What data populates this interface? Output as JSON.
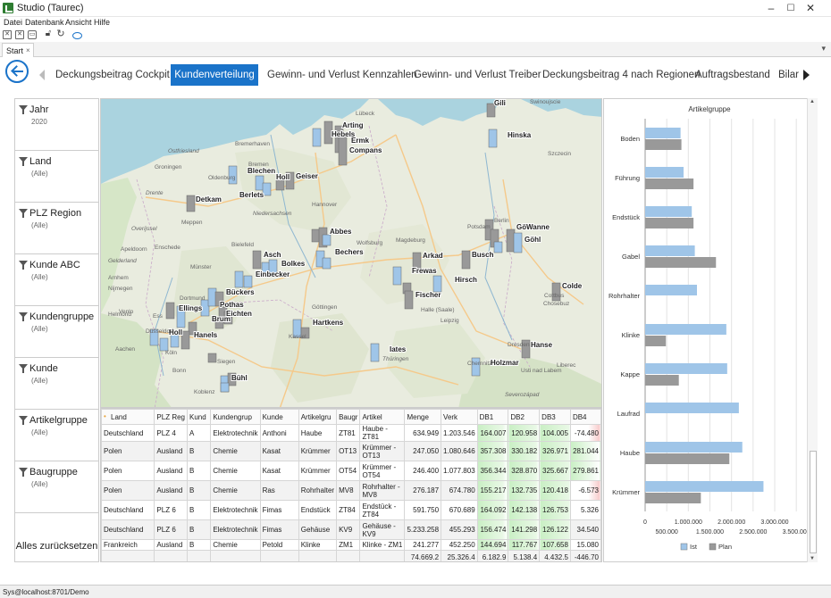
{
  "window": {
    "title": "Studio (Taurec)",
    "minimize": "–",
    "maximize": "☐",
    "close": "✕"
  },
  "menu": [
    "Datei",
    "Datenbank",
    "Ansicht",
    "Hilfe"
  ],
  "toolbar_icons": [
    "close-all-icon",
    "close-icon",
    "print-icon",
    "lock-icon",
    "refresh-icon",
    "eye-icon"
  ],
  "doc_tab": {
    "label": "Start",
    "close": "×",
    "dropdown": "▾"
  },
  "nav_tabs": [
    {
      "label": "Deckungsbeitrag Cockpit",
      "active": false
    },
    {
      "label": "Kundenverteilung",
      "active": true
    },
    {
      "label": "Gewinn- und Verlust Kennzahlen",
      "active": false
    },
    {
      "label": "Gewinn- und Verlust Treiber",
      "active": false
    },
    {
      "label": "Deckungsbeitrag 4 nach Regionen",
      "active": false
    },
    {
      "label": "Auftragsbestand",
      "active": false
    },
    {
      "label": "Bilar",
      "active": false
    }
  ],
  "filters": [
    {
      "name": "Jahr",
      "value": "2020"
    },
    {
      "name": "Land",
      "value": "(Alle)"
    },
    {
      "name": "PLZ Region",
      "value": "(Alle)"
    },
    {
      "name": "Kunde ABC",
      "value": "(Alle)"
    },
    {
      "name": "Kundengruppe",
      "value": "(Alle)"
    },
    {
      "name": "Kunde",
      "value": "(Alle)"
    },
    {
      "name": "Artikelgruppe",
      "value": "(Alle)"
    },
    {
      "name": "Baugruppe",
      "value": "(Alle)"
    }
  ],
  "reset_label": "Alles zurücksetzen",
  "map": {
    "cities": [
      {
        "name": "Lübeck",
        "kind": "region"
      },
      {
        "name": "Arting",
        "kind": "customer"
      },
      {
        "name": "Hebels",
        "kind": "customer"
      },
      {
        "name": "Ermk",
        "kind": "customer"
      },
      {
        "name": "Compans",
        "kind": "customer"
      },
      {
        "name": "Gili",
        "kind": "customer"
      },
      {
        "name": "Hinska",
        "kind": "customer"
      },
      {
        "name": "Swinoujscie",
        "kind": "region"
      },
      {
        "name": "Bremerhaven",
        "kind": "region"
      },
      {
        "name": "Szczecin",
        "kind": "region"
      },
      {
        "name": "Blechen",
        "kind": "customer"
      },
      {
        "name": "Holl",
        "kind": "customer"
      },
      {
        "name": "Geiser",
        "kind": "customer"
      },
      {
        "name": "Groningen",
        "kind": "region"
      },
      {
        "name": "Berlets",
        "kind": "customer"
      },
      {
        "name": "Detkam",
        "kind": "customer"
      },
      {
        "name": "Drente",
        "kind": "region"
      },
      {
        "name": "Niedersachsen",
        "kind": "region"
      },
      {
        "name": "Overijssel",
        "kind": "region"
      },
      {
        "name": "Abbes",
        "kind": "customer"
      },
      {
        "name": "Berlin",
        "kind": "region"
      },
      {
        "name": "Görr",
        "kind": "customer"
      },
      {
        "name": "Wanne",
        "kind": "customer"
      },
      {
        "name": "Göhl",
        "kind": "customer"
      },
      {
        "name": "Wolfsburg",
        "kind": "region"
      },
      {
        "name": "Enschede",
        "kind": "region"
      },
      {
        "name": "Apeldoorn",
        "kind": "region"
      },
      {
        "name": "Gelderland",
        "kind": "region"
      },
      {
        "name": "Asch",
        "kind": "customer"
      },
      {
        "name": "Bolkes",
        "kind": "customer"
      },
      {
        "name": "Bechers",
        "kind": "customer"
      },
      {
        "name": "Arkad",
        "kind": "customer"
      },
      {
        "name": "Busch",
        "kind": "customer"
      },
      {
        "name": "Arnhem",
        "kind": "region"
      },
      {
        "name": "Nijmegen",
        "kind": "region"
      },
      {
        "name": "Einbecker",
        "kind": "customer"
      },
      {
        "name": "Frewas",
        "kind": "customer"
      },
      {
        "name": "Hirsch",
        "kind": "customer"
      },
      {
        "name": "Colde",
        "kind": "customer"
      },
      {
        "name": "Cottbus",
        "kind": "region"
      },
      {
        "name": "Chosebuz",
        "kind": "region"
      },
      {
        "name": "Venlo",
        "kind": "region"
      },
      {
        "name": "Helmond",
        "kind": "region"
      },
      {
        "name": "Bückers",
        "kind": "customer"
      },
      {
        "name": "Ellings",
        "kind": "customer"
      },
      {
        "name": "Ess",
        "kind": "region"
      },
      {
        "name": "Pothas",
        "kind": "customer"
      },
      {
        "name": "Eichten",
        "kind": "customer"
      },
      {
        "name": "Brum",
        "kind": "customer"
      },
      {
        "name": "Göttingen",
        "kind": "region"
      },
      {
        "name": "Fischer",
        "kind": "customer"
      },
      {
        "name": "Halle (Saale)",
        "kind": "region"
      },
      {
        "name": "Leipzig",
        "kind": "region"
      },
      {
        "name": "Hartkens",
        "kind": "customer"
      },
      {
        "name": "Hanels",
        "kind": "customer"
      },
      {
        "name": "Holl",
        "kind": "customer"
      },
      {
        "name": "Köln",
        "kind": "region"
      },
      {
        "name": "Bonn",
        "kind": "region"
      },
      {
        "name": "Siegen",
        "kind": "region"
      },
      {
        "name": "Kassel",
        "kind": "region"
      },
      {
        "name": "Iates",
        "kind": "customer"
      },
      {
        "name": "Thüringen",
        "kind": "region"
      },
      {
        "name": "Hanse",
        "kind": "customer"
      },
      {
        "name": "Dresden",
        "kind": "region"
      },
      {
        "name": "Holzmar",
        "kind": "customer"
      },
      {
        "name": "Chemnitz",
        "kind": "region"
      },
      {
        "name": "Usti nad Labem",
        "kind": "region"
      },
      {
        "name": "Liberec",
        "kind": "region"
      },
      {
        "name": "Severozápad",
        "kind": "region"
      },
      {
        "name": "Bühl",
        "kind": "customer"
      },
      {
        "name": "Ostfriesland",
        "kind": "region"
      },
      {
        "name": "Meppen",
        "kind": "region"
      },
      {
        "name": "Oldenburg",
        "kind": "region"
      },
      {
        "name": "Bremen",
        "kind": "region"
      },
      {
        "name": "Hannover",
        "kind": "region"
      },
      {
        "name": "Münster",
        "kind": "region"
      },
      {
        "name": "Bielefeld",
        "kind": "region"
      },
      {
        "name": "Dortmund",
        "kind": "region"
      },
      {
        "name": "Düsseldorf",
        "kind": "region"
      },
      {
        "name": "Aachen",
        "kind": "region"
      },
      {
        "name": "Koblenz",
        "kind": "region"
      },
      {
        "name": "Magdeburg",
        "kind": "region"
      },
      {
        "name": "Potsdam",
        "kind": "region"
      }
    ]
  },
  "grid": {
    "columns": [
      "Land",
      "PLZ Reg",
      "Kund",
      "Kundengrup",
      "Kunde",
      "Artikelgru",
      "Baugr",
      "Artikel",
      "Menge",
      "Verk",
      "DB1",
      "DB2",
      "DB3",
      "DB4"
    ],
    "rows": [
      [
        "Deutschland",
        "PLZ 4",
        "A",
        "Elektrotechnik",
        "Anthoni",
        "Haube",
        "ZT81",
        "Haube - ZT81",
        "634.949",
        "1.203.546",
        "164.007",
        "120.958",
        "104.005",
        "-74.480"
      ],
      [
        "Polen",
        "Ausland",
        "B",
        "Chemie",
        "Kasat",
        "Krümmer",
        "OT13",
        "Krümmer - OT13",
        "247.050",
        "1.080.646",
        "357.308",
        "330.182",
        "326.971",
        "281.044"
      ],
      [
        "Polen",
        "Ausland",
        "B",
        "Chemie",
        "Kasat",
        "Krümmer",
        "OT54",
        "Krümmer - OT54",
        "246.400",
        "1.077.803",
        "356.344",
        "328.870",
        "325.667",
        "279.861"
      ],
      [
        "Polen",
        "Ausland",
        "B",
        "Chemie",
        "Ras",
        "Rohrhalter",
        "MV8",
        "Rohrhalter - MV8",
        "276.187",
        "674.780",
        "155.217",
        "132.735",
        "120.418",
        "-6.573"
      ],
      [
        "Deutschland",
        "PLZ 6",
        "B",
        "Elektrotechnik",
        "Fimas",
        "Endstück",
        "ZT84",
        "Endstück - ZT84",
        "591.750",
        "670.689",
        "164.092",
        "142.138",
        "126.753",
        "5.326"
      ],
      [
        "Deutschland",
        "PLZ 6",
        "B",
        "Elektrotechnik",
        "Fimas",
        "Gehäuse",
        "KV9",
        "Gehäuse - KV9",
        "5.233.258",
        "455.293",
        "156.474",
        "141.298",
        "126.122",
        "34.540"
      ],
      [
        "Frankreich",
        "Ausland",
        "B",
        "Chemie",
        "Petold",
        "Klinke",
        "ZM1",
        "Klinke - ZM1",
        "241.277",
        "452.250",
        "144.694",
        "117.767",
        "107.658",
        "15.080"
      ]
    ],
    "totals": [
      "",
      "",
      "",
      "",
      "",
      "",
      "",
      "",
      "74.669.2",
      "25.326.4",
      "6.182.9",
      "5.138.4",
      "4.432.5",
      "-446.70"
    ]
  },
  "chart_data": {
    "type": "bar",
    "orientation": "horizontal",
    "title": "Artikelgruppe",
    "categories": [
      "Boden",
      "Führung",
      "Endstück",
      "Gabel",
      "Rohrhalter",
      "Klinke",
      "Kappe",
      "Laufrad",
      "Haube",
      "Krümmer"
    ],
    "series": [
      {
        "name": "Ist",
        "color": "#9fc5e8",
        "values": [
          820000,
          890000,
          1080000,
          1150000,
          1200000,
          1880000,
          1900000,
          2170000,
          2250000,
          2740000
        ]
      },
      {
        "name": "Plan",
        "color": "#999999",
        "values": [
          840000,
          1120000,
          1120000,
          1640000,
          0,
          480000,
          780000,
          0,
          1950000,
          1290000
        ]
      }
    ],
    "xlim": [
      0,
      3600000
    ],
    "ticks_top": [
      "1.000.000",
      "2.000.000",
      "3.000.000"
    ],
    "ticks_bottom": [
      "500.000",
      "1.500.000",
      "2.500.000",
      "3.500.000"
    ],
    "legend_placement": "bottom",
    "grid": true
  },
  "status": "Sys@localhost:8701/Demo"
}
